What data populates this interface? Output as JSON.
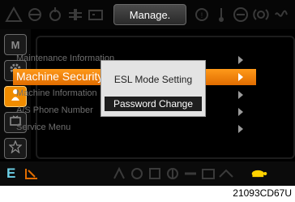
{
  "header": {
    "title": "Manage.",
    "indicator_icons": [
      "warning-icon",
      "oil-pressure-icon",
      "hydraulic-temp-icon",
      "coolant-temp-icon",
      "battery-icon",
      "overload-icon",
      "preheat-icon",
      "engine-check-icon",
      "brake-icon",
      "glow-icon"
    ]
  },
  "side_tabs": [
    {
      "label": "M",
      "icon": "mode-letter"
    },
    {
      "label": "",
      "icon": "gear-icon"
    },
    {
      "label": "",
      "icon": "person-icon",
      "active": true
    },
    {
      "label": "",
      "icon": "monitor-icon"
    },
    {
      "label": "",
      "icon": "star-icon"
    }
  ],
  "menu": {
    "items": [
      {
        "label": "Maintenance Information",
        "selected": false
      },
      {
        "label": "Machine Security",
        "selected": true
      },
      {
        "label": "Machine Information",
        "selected": false
      },
      {
        "label": "A/S Phone Number",
        "selected": false
      },
      {
        "label": "Service Menu",
        "selected": false
      }
    ]
  },
  "popup": {
    "options": [
      "ESL Mode Setting",
      "Password Change"
    ],
    "highlighted_index": 1
  },
  "footer": {
    "mode_letter": "E",
    "icons": [
      "power-mode-icon",
      "work-tool-icon",
      "travel-icon",
      "auto-idle-icon",
      "fuel-icon",
      "heater-icon",
      "camera-icon",
      "wiper-icon",
      "tortoise-icon"
    ]
  },
  "caption": "21093CD67U",
  "colors": {
    "accent_orange": "#f08c00",
    "mode_letter": "#6ccfe6",
    "turtle_yellow": "#ffd200"
  }
}
